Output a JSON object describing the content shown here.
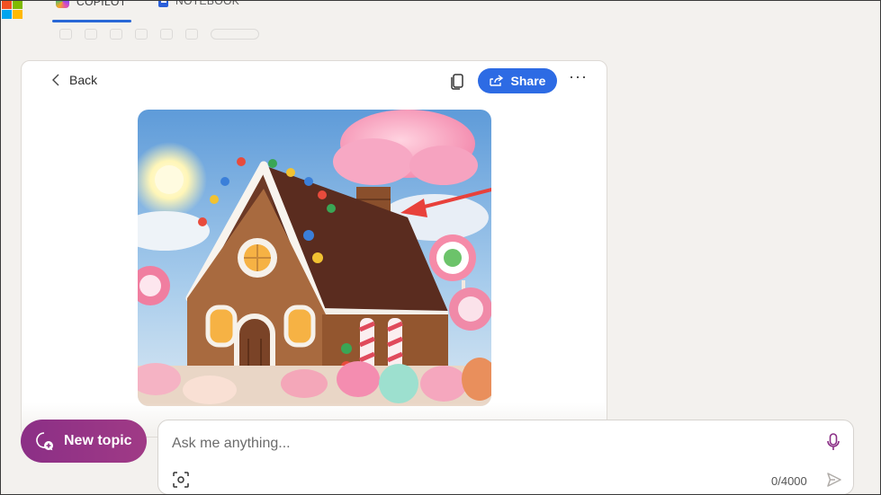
{
  "tabs": [
    {
      "label": "COPILOT",
      "icon": "copilot-icon",
      "active": true
    },
    {
      "label": "NOTEBOOK",
      "icon": "notebook-icon",
      "active": false
    }
  ],
  "card": {
    "back_label": "Back",
    "share_label": "Share",
    "image_alt": "gingerbread-house-image"
  },
  "composer": {
    "new_topic_label": "New topic",
    "placeholder": "Ask me anything...",
    "char_count": "0/4000"
  },
  "colors": {
    "accent_blue": "#2d6be4",
    "new_topic_purple": "#8b2f86",
    "annotation_arrow": "#e8413b"
  }
}
